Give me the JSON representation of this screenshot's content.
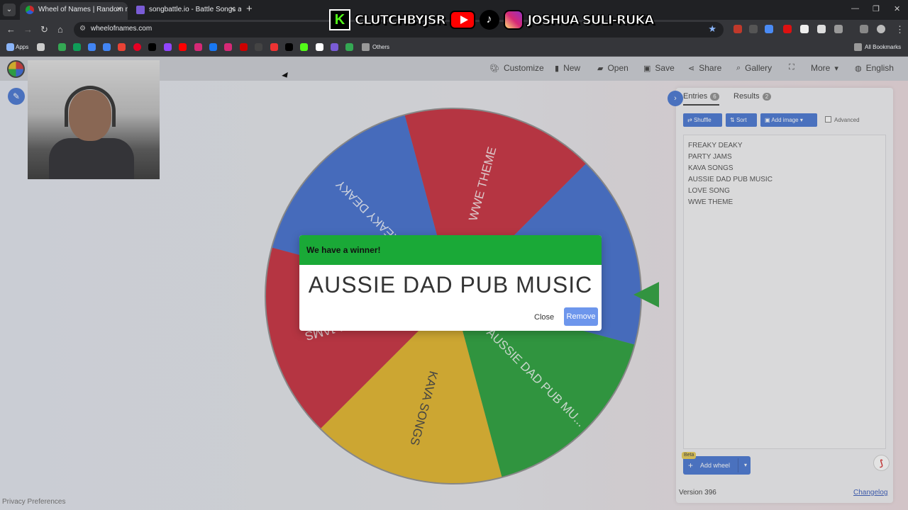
{
  "browser": {
    "tabs": [
      {
        "title": "Wheel of Names | Random nam",
        "active": true
      },
      {
        "title": "songbattle.io - Battle Songs ag",
        "active": false
      }
    ],
    "url": "wheelofnames.com",
    "bookmarks": {
      "apps": "Apps",
      "others": "Others",
      "all": "All Bookmarks"
    }
  },
  "banner": {
    "brand": "CLUTCHBYJSR",
    "name": "JOSHUA SULI-RUKA"
  },
  "toolbar": {
    "customize": "Customize",
    "new": "New",
    "open": "Open",
    "save": "Save",
    "share": "Share",
    "gallery": "Gallery",
    "more": "More",
    "language": "English"
  },
  "wheel": {
    "slices": [
      {
        "label": "WWE THEME",
        "color": "#c42131"
      },
      {
        "label": "LOVE SONG",
        "color": "#3766cc"
      },
      {
        "label": "AUSSIE DAD PUB MU...",
        "color": "#1a9a2e"
      },
      {
        "label": "KAVA SONGS",
        "color": "#e2b11d"
      },
      {
        "label": "PARTY JAMS",
        "color": "#c42131"
      },
      {
        "label": "FREAKY DEAKY",
        "color": "#3766cc"
      }
    ]
  },
  "panel": {
    "entries_tab": "Entries",
    "entries_count": "6",
    "results_tab": "Results",
    "results_count": "2",
    "shuffle": "Shuffle",
    "sort": "Sort",
    "add_image": "Add image",
    "advanced": "Advanced",
    "entries": [
      "FREAKY DEAKY",
      "PARTY JAMS",
      "KAVA SONGS",
      "AUSSIE DAD PUB MUSIC",
      "LOVE SONG",
      "WWE THEME"
    ],
    "beta": "Beta",
    "add_wheel": "Add wheel",
    "version": "Version 396",
    "changelog": "Changelog"
  },
  "privacy": "Privacy Preferences",
  "modal": {
    "title": "We have a winner!",
    "winner": "AUSSIE DAD PUB MUSIC",
    "close": "Close",
    "remove": "Remove"
  }
}
